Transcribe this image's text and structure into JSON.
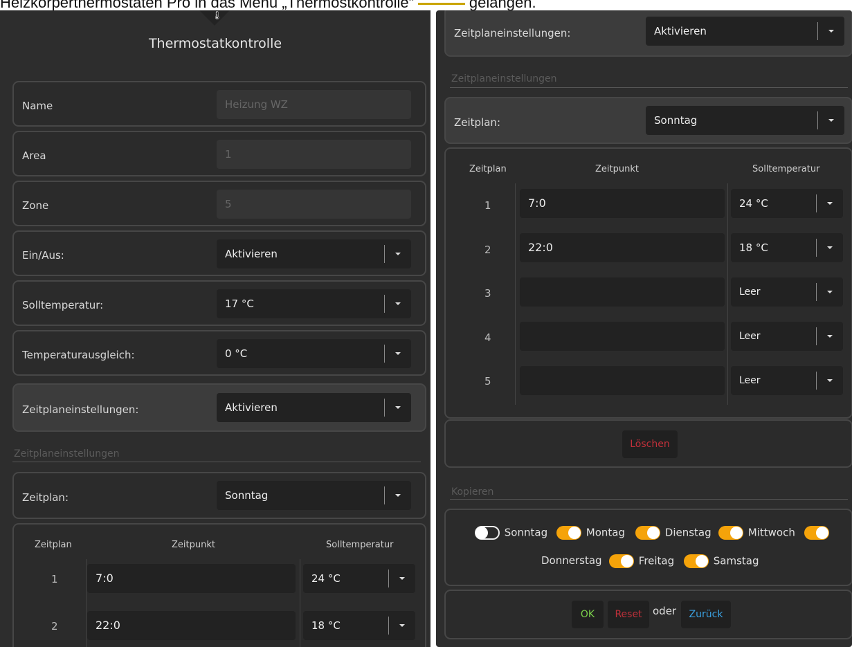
{
  "headline": {
    "pre": "Heizkörperthermostaten Pro in das Menü „Thermostkontrolle“",
    "post": "gelangen."
  },
  "left": {
    "title": "Thermostatkontrolle",
    "name": {
      "label": "Name",
      "placeholder": "Heizung WZ"
    },
    "area": {
      "label": "Area",
      "placeholder": "1"
    },
    "zone": {
      "label": "Zone",
      "placeholder": "5"
    },
    "einaus": {
      "label": "Ein/Aus:",
      "value": "Aktivieren"
    },
    "solltemp": {
      "label": "Solltemperatur:",
      "value": "17 °C"
    },
    "ausgleich": {
      "label": "Temperaturausgleich:",
      "value": "0 °C"
    },
    "zeitplaneinst": {
      "label": "Zeitplaneinstellungen:",
      "value": "Aktivieren"
    },
    "section_title": "Zeitplaneinstellungen",
    "zeitplan": {
      "label": "Zeitplan:",
      "value": "Sonntag"
    },
    "table": {
      "headers": [
        "Zeitplan",
        "Zeitpunkt",
        "Solltemperatur"
      ],
      "rows": [
        {
          "n": "1",
          "time": "7:0",
          "temp": "24 °C"
        },
        {
          "n": "2",
          "time": "22:0",
          "temp": "18 °C"
        }
      ]
    }
  },
  "right": {
    "zeitplaneinst": {
      "label": "Zeitplaneinstellungen:",
      "value": "Aktivieren"
    },
    "section_title": "Zeitplaneinstellungen",
    "zeitplan": {
      "label": "Zeitplan:",
      "value": "Sonntag"
    },
    "table": {
      "headers": [
        "Zeitplan",
        "Zeitpunkt",
        "Solltemperatur"
      ],
      "rows": [
        {
          "n": "1",
          "time": "7:0",
          "temp": "24 °C"
        },
        {
          "n": "2",
          "time": "22:0",
          "temp": "18 °C"
        },
        {
          "n": "3",
          "time": "",
          "temp": "Leer"
        },
        {
          "n": "4",
          "time": "",
          "temp": "Leer"
        },
        {
          "n": "5",
          "time": "",
          "temp": "Leer"
        }
      ]
    },
    "delete_label": "Löschen",
    "copy_title": "Kopieren",
    "days": [
      {
        "label": "Sonntag",
        "on": false
      },
      {
        "label": "Montag",
        "on": true
      },
      {
        "label": "Dienstag",
        "on": true
      },
      {
        "label": "Mittwoch",
        "on": true
      },
      {
        "label": "Donnerstag",
        "on": true
      },
      {
        "label": "Freitag",
        "on": true
      },
      {
        "label": "Samstag",
        "on": true
      }
    ],
    "ok_label": "OK",
    "reset_label": "Reset",
    "oder_label": "oder",
    "back_label": "Zurück"
  },
  "colors": {
    "toggle_on": "#f5a30a",
    "ok_text": "#7bd14b",
    "reset_text": "#c0303a",
    "back_text": "#3aa0e0",
    "delete_text": "#c0303a"
  }
}
